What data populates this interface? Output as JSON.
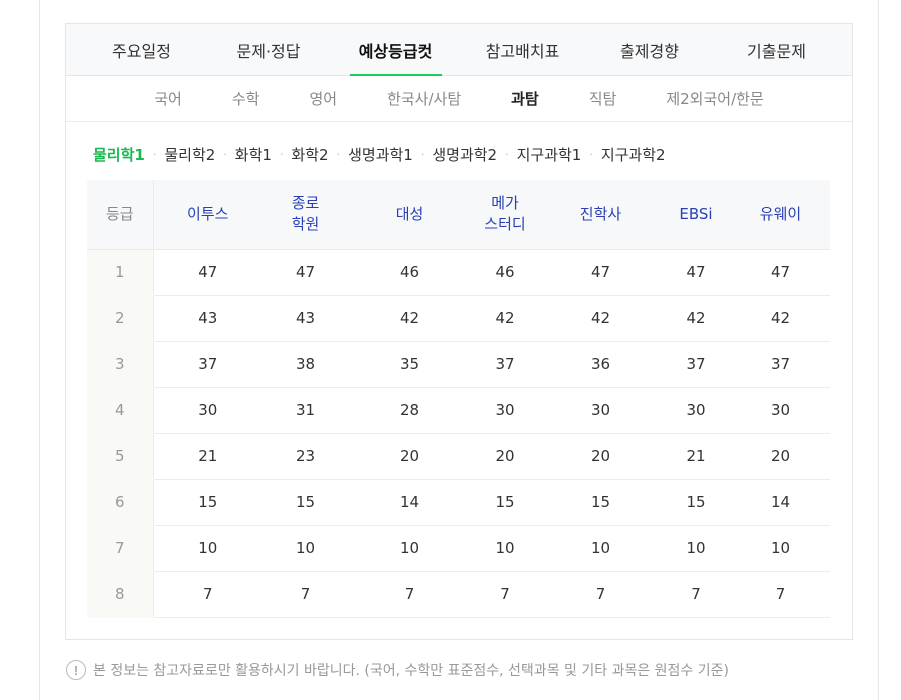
{
  "main_tabs": [
    "주요일정",
    "문제·정답",
    "예상등급컷",
    "참고배치표",
    "출제경향",
    "기출문제"
  ],
  "main_active": 2,
  "sub_tabs": [
    "국어",
    "수학",
    "영어",
    "한국사/사탐",
    "과탐",
    "직탐",
    "제2외국어/한문"
  ],
  "sub_active": 4,
  "subjects": [
    "물리학1",
    "물리학2",
    "화학1",
    "화학2",
    "생명과학1",
    "생명과학2",
    "지구과학1",
    "지구과학2"
  ],
  "subject_active": 0,
  "table": {
    "grade_header": "등급",
    "providers": [
      [
        "이투스"
      ],
      [
        "종로",
        "학원"
      ],
      [
        "대성"
      ],
      [
        "메가",
        "스터디"
      ],
      [
        "진학사"
      ],
      [
        "EBSi"
      ],
      [
        "유웨이"
      ]
    ],
    "rows": [
      {
        "grade": "1",
        "cuts": [
          "47",
          "47",
          "46",
          "46",
          "47",
          "47",
          "47"
        ]
      },
      {
        "grade": "2",
        "cuts": [
          "43",
          "43",
          "42",
          "42",
          "42",
          "42",
          "42"
        ]
      },
      {
        "grade": "3",
        "cuts": [
          "37",
          "38",
          "35",
          "37",
          "36",
          "37",
          "37"
        ]
      },
      {
        "grade": "4",
        "cuts": [
          "30",
          "31",
          "28",
          "30",
          "30",
          "30",
          "30"
        ]
      },
      {
        "grade": "5",
        "cuts": [
          "21",
          "23",
          "20",
          "20",
          "20",
          "21",
          "20"
        ]
      },
      {
        "grade": "6",
        "cuts": [
          "15",
          "15",
          "14",
          "15",
          "15",
          "15",
          "14"
        ]
      },
      {
        "grade": "7",
        "cuts": [
          "10",
          "10",
          "10",
          "10",
          "10",
          "10",
          "10"
        ]
      },
      {
        "grade": "8",
        "cuts": [
          "7",
          "7",
          "7",
          "7",
          "7",
          "7",
          "7"
        ]
      }
    ]
  },
  "notice": {
    "icon": "exclamation-circle-icon",
    "text": "본 정보는 참고자료로만 활용하시기 바랍니다. (국어, 수학만 표준점수, 선택과목 및 기타 과목은 원점수 기준)"
  },
  "colors": {
    "accent_green": "#19ce60",
    "active_subject": "#19b94f",
    "provider_blue": "#2a3fb5"
  }
}
